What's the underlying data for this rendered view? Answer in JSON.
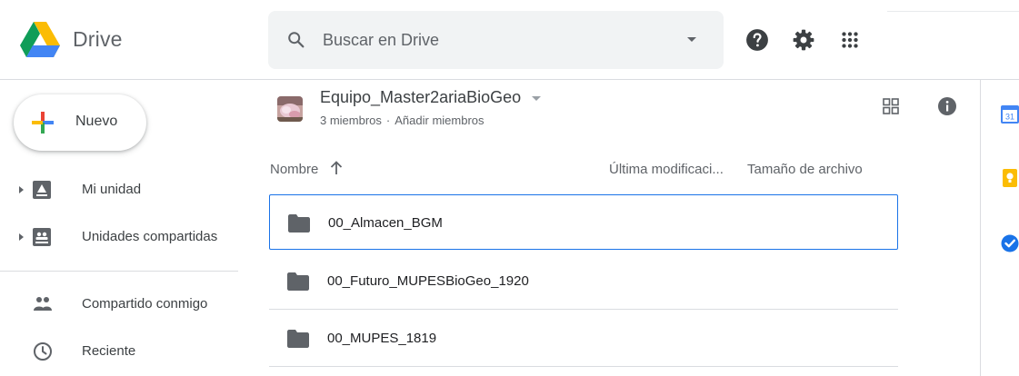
{
  "app": {
    "title": "Drive"
  },
  "search": {
    "placeholder": "Buscar en Drive"
  },
  "sidebar": {
    "new_label": "Nuevo",
    "items": [
      {
        "label": "Mi unidad",
        "icon": "my-drive-icon"
      },
      {
        "label": "Unidades compartidas",
        "icon": "shared-drives-icon"
      },
      {
        "label": "Compartido conmigo",
        "icon": "people-icon"
      },
      {
        "label": "Reciente",
        "icon": "clock-icon"
      }
    ]
  },
  "folder": {
    "name": "Equipo_Master2ariaBioGeo",
    "members": "3 miembros",
    "separator": "·",
    "add_members": "Añadir miembros"
  },
  "columns": {
    "name": "Nombre",
    "modified": "Última modificaci...",
    "size": "Tamaño de archivo"
  },
  "files": [
    {
      "name": "00_Almacen_BGM",
      "selected": true
    },
    {
      "name": "00_Futuro_MUPESBioGeo_1920",
      "selected": false
    },
    {
      "name": "00_MUPES_1819",
      "selected": false
    }
  ],
  "side_apps": {
    "calendar_day": "31"
  },
  "colors": {
    "accent": "#1a73e8",
    "google_green": "#34a853",
    "google_yellow": "#fbbc04",
    "google_red": "#ea4335",
    "google_blue": "#4285f4"
  }
}
